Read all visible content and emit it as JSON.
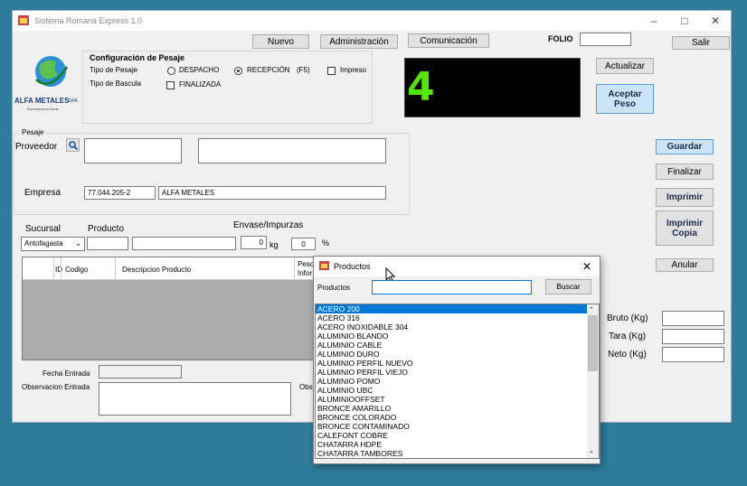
{
  "window": {
    "title": "Sistema Romana Express 1.0"
  },
  "toolbar": {
    "nuevo": "Nuevo",
    "administracion": "Administración",
    "comunicacion": "Comunicación",
    "folio_label": "FOLIO",
    "folio_value": "",
    "salir": "Salir"
  },
  "logo": {
    "name": "ALFA METALES",
    "suffix": "SPA.",
    "tagline": "Reciclando el Norte"
  },
  "config": {
    "title": "Configuración de Pesaje",
    "tipo_pesaje_label": "Tipo de Pesaje",
    "despacho": "DESPACHO",
    "recepcion": "RECEPCIÓN",
    "f5": "(F5)",
    "impreso": "Impreso",
    "tipo_bascula_label": "Tipo de Bascula",
    "finalizada": "FINALIZADA"
  },
  "display": {
    "value": "4"
  },
  "actions": {
    "actualizar": "Actualizar",
    "aceptar_peso": "Aceptar Peso",
    "guardar": "Guardar",
    "finalizar": "Finalizar",
    "imprimir": "Imprimir",
    "imprimir_copia": "Imprimir Copia",
    "anular": "Anular"
  },
  "pesaje": {
    "title": "Pesaje",
    "proveedor_label": "Proveedor",
    "proveedor_code": "",
    "proveedor_name": "",
    "empresa_label": "Empresa",
    "empresa_rut": "77.044.205-2",
    "empresa_name": "ALFA METALES"
  },
  "producto_row": {
    "sucursal_label": "Sucursal",
    "sucursal_value": "Antofagasta",
    "producto_label": "Producto",
    "envase_label": "Envase/Impurzas",
    "kg_value": "0",
    "kg_unit": "kg",
    "pct_value": "0",
    "pct_unit": "%"
  },
  "grid": {
    "columns": [
      "ID",
      "Codigo",
      "Descripcion Producto",
      "Peso Infor"
    ]
  },
  "weights": {
    "bruto": "Bruto (Kg)",
    "tara": "Tara (Kg)",
    "neto": "Neto (Kg)"
  },
  "entrada": {
    "fecha_label": "Fecha Entrada",
    "obs_label": "Observacion Entrada",
    "obs_right_label": "Obs"
  },
  "popup": {
    "title": "Productos",
    "search_label": "Productos",
    "search_value": "",
    "buscar": "Buscar",
    "selected": "ACERO 200",
    "items": [
      "ACERO 200",
      "ACERO 316",
      "ACERO INOXIDABLE 304",
      "ALUMINIO BLANDO",
      "ALUMINIO CABLE",
      "ALUMINIO DURO",
      "ALUMINIO PERFIL NUEVO",
      "ALUMINIO PERFIL VIEJO",
      "ALUMINIO POMO",
      "ALUMINIO UBC",
      "ALUMINIOOFFSET",
      "BRONCE AMARILLO",
      "BRONCE COLORADO",
      "BRONCE CONTAMINADO",
      "CALEFONT COBRE",
      "CHATARRA HDPE",
      "CHATARRA TAMBORES"
    ]
  }
}
